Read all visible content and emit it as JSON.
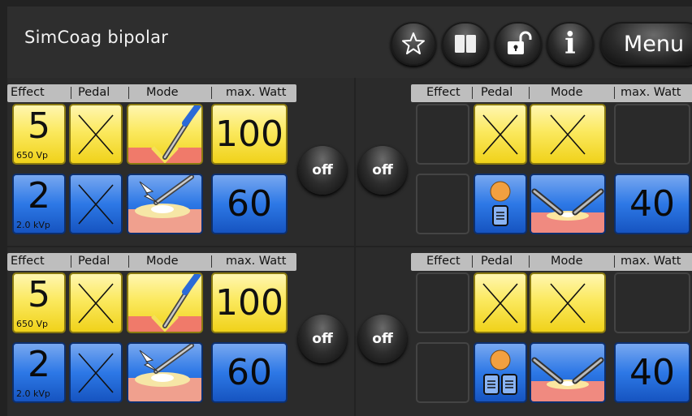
{
  "header": {
    "title": "SimCoag bipolar",
    "menu_label": "Menu",
    "info_label": "i",
    "icons": [
      "star-icon",
      "book-icon",
      "unlock-icon",
      "info-icon"
    ]
  },
  "columns": {
    "effect": "Effect",
    "pedal": "Pedal",
    "mode": "Mode",
    "max_watt": "max. Watt"
  },
  "off_label": "off",
  "rows": [
    {
      "left": {
        "upper": {
          "effect": "5",
          "effect_sub": "650 Vp",
          "pedal": "none",
          "mode": "cut-electrode",
          "max_watt": "100"
        },
        "lower": {
          "effect": "2",
          "effect_sub": "2.0 kVp",
          "pedal": "none",
          "mode": "spark-coag",
          "max_watt": "60"
        }
      },
      "right": {
        "upper": {
          "effect": "",
          "pedal": "none",
          "mode": "none",
          "max_watt": ""
        },
        "lower": {
          "effect": "",
          "pedal": "footswitch-single",
          "mode": "bipolar-forceps",
          "max_watt": "40"
        }
      }
    },
    {
      "left": {
        "upper": {
          "effect": "5",
          "effect_sub": "650 Vp",
          "pedal": "none",
          "mode": "cut-electrode",
          "max_watt": "100"
        },
        "lower": {
          "effect": "2",
          "effect_sub": "2.0 kVp",
          "pedal": "none",
          "mode": "spark-coag",
          "max_watt": "60"
        }
      },
      "right": {
        "upper": {
          "effect": "",
          "pedal": "none",
          "mode": "none",
          "max_watt": ""
        },
        "lower": {
          "effect": "",
          "pedal": "footswitch-double",
          "mode": "bipolar-forceps",
          "max_watt": "40"
        }
      }
    }
  ],
  "colors": {
    "yellow": "#f6e03a",
    "blue": "#2d78e6",
    "background": "#2b2b2b"
  }
}
